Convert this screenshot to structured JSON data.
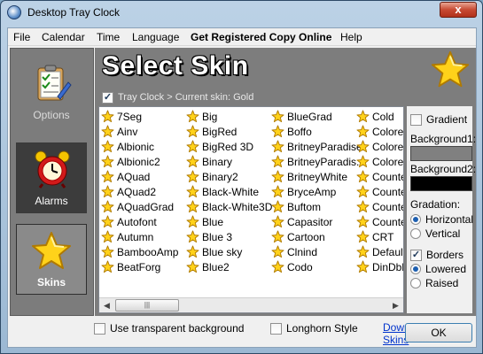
{
  "window": {
    "title": "Desktop Tray Clock",
    "close_symbol": "x"
  },
  "menu": [
    "File",
    "Calendar",
    "Time",
    "Language",
    "Get Registered Copy Online",
    "Help"
  ],
  "nav": {
    "options": "Options",
    "alarms": "Alarms",
    "skins": "Skins"
  },
  "banner": {
    "title": "Select Skin"
  },
  "current_skin": {
    "checked": true,
    "text": "Tray Clock > Current skin: Gold"
  },
  "skins": [
    [
      "7Seg",
      "Ainv",
      "Albionic",
      "Albionic2",
      "AQuad",
      "AQuad2",
      "AQuadGrad",
      "Autofont",
      "Autumn",
      "BambooAmp",
      "BeatForg"
    ],
    [
      "Big",
      "BigRed",
      "BigRed 3D",
      "Binary",
      "Binary2",
      "Black-White",
      "Black-White3D",
      "Blue",
      "Blue 3",
      "Blue sky",
      "Blue2"
    ],
    [
      "BlueGrad",
      "Boffo",
      "BritneyParadise",
      "BritneyParadis...",
      "BritneyWhite",
      "BryceAmp",
      "Buftom",
      "Capasitor",
      "Cartoon",
      "Clnind",
      "Codo"
    ],
    [
      "Cold",
      "Colored",
      "Colored",
      "Colored",
      "Counte",
      "Counte",
      "Counte",
      "Counte",
      "CRT",
      "Default",
      "DinDbl"
    ]
  ],
  "options": {
    "gradient": "Gradient",
    "background1": "Background1:",
    "background2": "Background2:",
    "background1_color": "#808080",
    "background2_color": "#000000",
    "gradation": "Gradation:",
    "horizontal": "Horizontal",
    "vertical": "Vertical",
    "borders": "Borders",
    "lowered": "Lowered",
    "raised": "Raised"
  },
  "bottom": {
    "transparent": "Use transparent background",
    "longhorn": "Longhorn Style",
    "download": "Download more Skins",
    "ok": "OK"
  },
  "icons": {
    "star": "star-icon",
    "options": "clipboard-check-icon",
    "alarms": "alarm-clock-icon"
  }
}
